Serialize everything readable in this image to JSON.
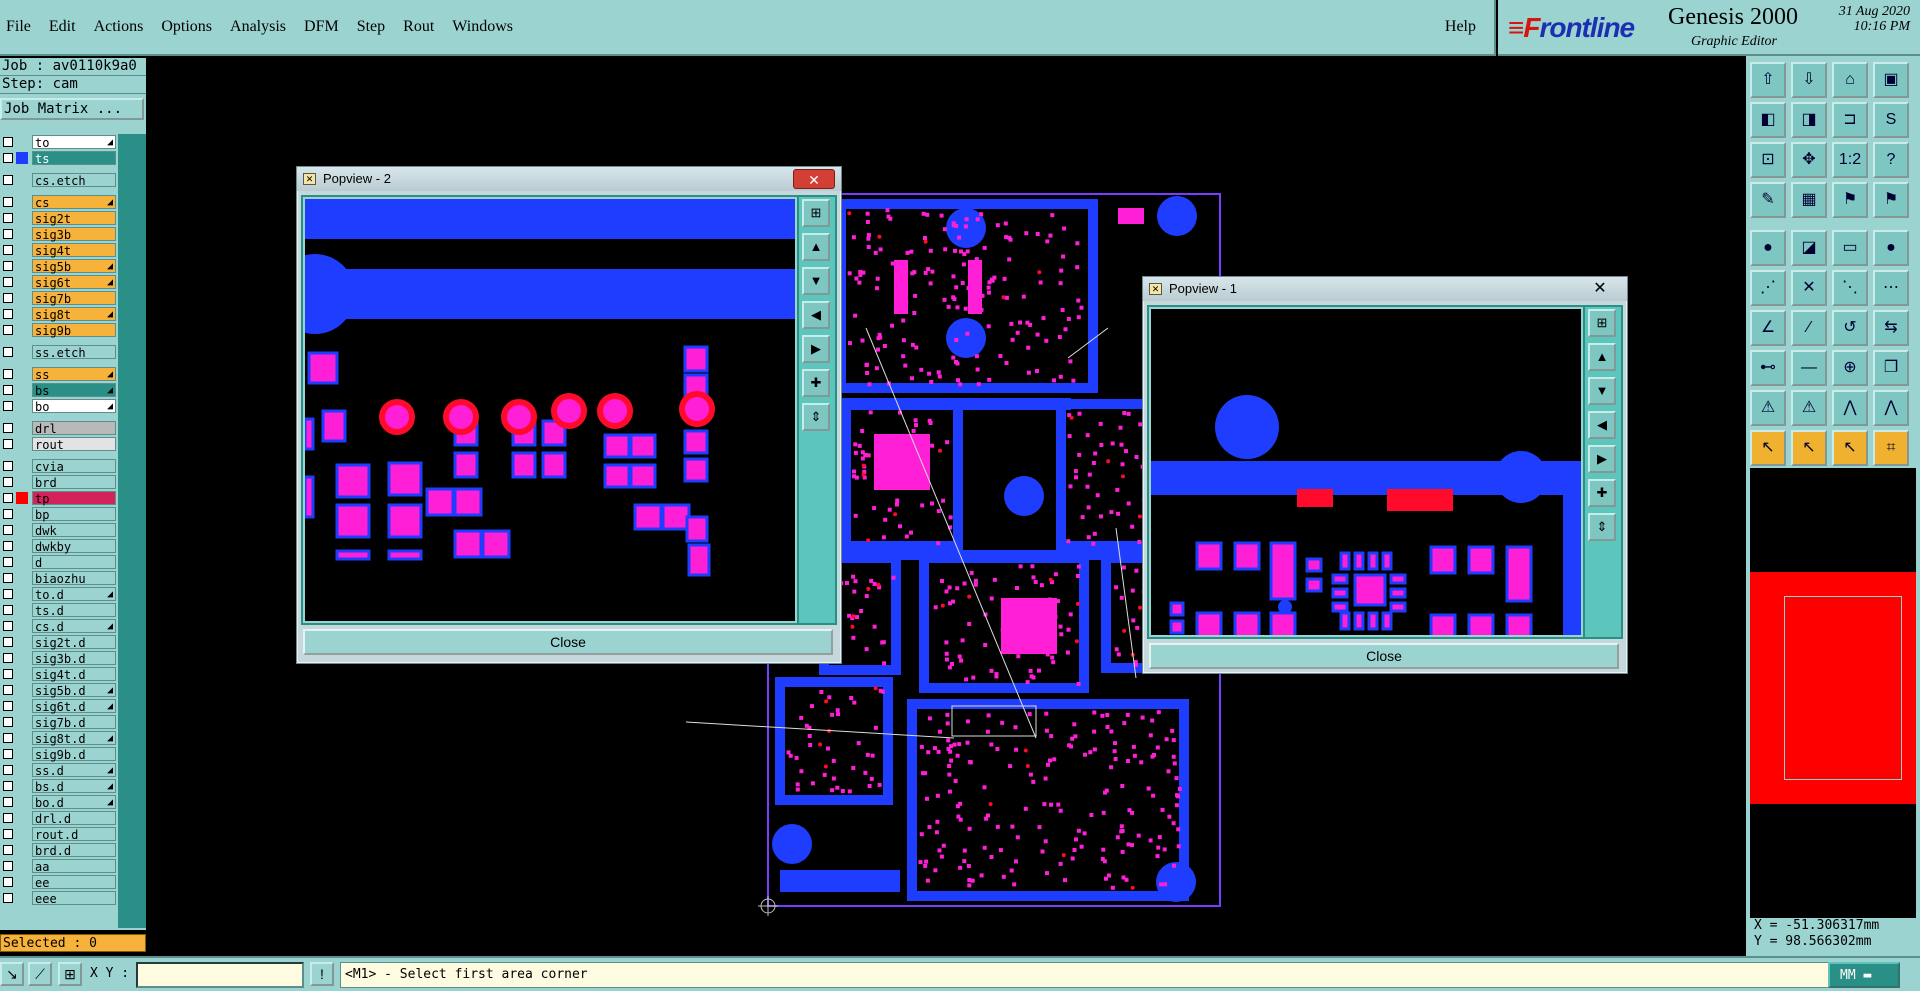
{
  "menu": {
    "items": [
      "File",
      "Edit",
      "Actions",
      "Options",
      "Analysis",
      "DFM",
      "Step",
      "Rout",
      "Windows"
    ],
    "help": "Help"
  },
  "brand": {
    "logo": "Frontline",
    "title": "Genesis 2000",
    "subtitle": "Graphic Editor",
    "date": "31 Aug 2020",
    "time": "10:16 PM"
  },
  "job": {
    "job_line": "Job : av0110k9a0",
    "step_line": "Step: cam",
    "matrix_button": "Job Matrix ..."
  },
  "layers": [
    {
      "name": "to",
      "color": "#ffffff",
      "indicator": "",
      "arrow": true,
      "group": 1
    },
    {
      "name": "ts",
      "color": "#2a8f86",
      "indicator": "#1f3dff",
      "arrow": false,
      "group": 1,
      "text_color": "#ffffff"
    },
    {
      "name": "cs.etch",
      "color": "#9bd3d0",
      "indicator": "",
      "arrow": false,
      "group": 2
    },
    {
      "name": "cs",
      "color": "#f6b23a",
      "indicator": "",
      "arrow": true,
      "group": 3
    },
    {
      "name": "sig2t",
      "color": "#f6b23a",
      "indicator": "",
      "arrow": false,
      "group": 3
    },
    {
      "name": "sig3b",
      "color": "#f6b23a",
      "indicator": "",
      "arrow": false,
      "group": 3
    },
    {
      "name": "sig4t",
      "color": "#f6b23a",
      "indicator": "",
      "arrow": false,
      "group": 3
    },
    {
      "name": "sig5b",
      "color": "#f6b23a",
      "indicator": "",
      "arrow": true,
      "group": 3
    },
    {
      "name": "sig6t",
      "color": "#f6b23a",
      "indicator": "",
      "arrow": true,
      "group": 3
    },
    {
      "name": "sig7b",
      "color": "#f6b23a",
      "indicator": "",
      "arrow": false,
      "group": 3
    },
    {
      "name": "sig8t",
      "color": "#f6b23a",
      "indicator": "",
      "arrow": true,
      "group": 3
    },
    {
      "name": "sig9b",
      "color": "#f6b23a",
      "indicator": "",
      "arrow": false,
      "group": 3
    },
    {
      "name": "ss.etch",
      "color": "#9bd3d0",
      "indicator": "",
      "arrow": false,
      "group": 4
    },
    {
      "name": "ss",
      "color": "#f6b23a",
      "indicator": "",
      "arrow": true,
      "group": 5
    },
    {
      "name": "bs",
      "color": "#2a8f86",
      "indicator": "",
      "arrow": true,
      "group": 5
    },
    {
      "name": "bo",
      "color": "#ffffff",
      "indicator": "",
      "arrow": true,
      "group": 5
    },
    {
      "name": "drl",
      "color": "#b9b9b9",
      "indicator": "",
      "arrow": false,
      "group": 6
    },
    {
      "name": "rout",
      "color": "#e3e3e3",
      "indicator": "",
      "arrow": false,
      "group": 6
    },
    {
      "name": "cvia",
      "color": "#9bd3d0",
      "indicator": "",
      "arrow": false,
      "group": 7
    },
    {
      "name": "brd",
      "color": "#9bd3d0",
      "indicator": "",
      "arrow": false,
      "group": 7
    },
    {
      "name": "tp",
      "color": "#d4225b",
      "indicator": "#ff0000",
      "arrow": false,
      "group": 7,
      "text_color": "#000000",
      "left_mark": "#1f3dff"
    },
    {
      "name": "bp",
      "color": "#9bd3d0",
      "indicator": "",
      "arrow": false,
      "group": 7
    },
    {
      "name": "dwk",
      "color": "#9bd3d0",
      "indicator": "",
      "arrow": false,
      "group": 7
    },
    {
      "name": "dwkby",
      "color": "#9bd3d0",
      "indicator": "",
      "arrow": false,
      "group": 7
    },
    {
      "name": "d",
      "color": "#9bd3d0",
      "indicator": "",
      "arrow": false,
      "group": 7
    },
    {
      "name": "biaozhu",
      "color": "#9bd3d0",
      "indicator": "",
      "arrow": false,
      "group": 7
    },
    {
      "name": "to.d",
      "color": "#9bd3d0",
      "indicator": "",
      "arrow": true,
      "group": 7
    },
    {
      "name": "ts.d",
      "color": "#9bd3d0",
      "indicator": "",
      "arrow": false,
      "group": 7
    },
    {
      "name": "cs.d",
      "color": "#9bd3d0",
      "indicator": "",
      "arrow": true,
      "group": 7
    },
    {
      "name": "sig2t.d",
      "color": "#9bd3d0",
      "indicator": "",
      "arrow": false,
      "group": 7
    },
    {
      "name": "sig3b.d",
      "color": "#9bd3d0",
      "indicator": "",
      "arrow": false,
      "group": 7
    },
    {
      "name": "sig4t.d",
      "color": "#9bd3d0",
      "indicator": "",
      "arrow": false,
      "group": 7
    },
    {
      "name": "sig5b.d",
      "color": "#9bd3d0",
      "indicator": "",
      "arrow": true,
      "group": 7
    },
    {
      "name": "sig6t.d",
      "color": "#9bd3d0",
      "indicator": "",
      "arrow": true,
      "group": 7
    },
    {
      "name": "sig7b.d",
      "color": "#9bd3d0",
      "indicator": "",
      "arrow": false,
      "group": 7
    },
    {
      "name": "sig8t.d",
      "color": "#9bd3d0",
      "indicator": "",
      "arrow": true,
      "group": 7
    },
    {
      "name": "sig9b.d",
      "color": "#9bd3d0",
      "indicator": "",
      "arrow": false,
      "group": 7
    },
    {
      "name": "ss.d",
      "color": "#9bd3d0",
      "indicator": "",
      "arrow": true,
      "group": 7
    },
    {
      "name": "bs.d",
      "color": "#9bd3d0",
      "indicator": "",
      "arrow": true,
      "group": 7
    },
    {
      "name": "bo.d",
      "color": "#9bd3d0",
      "indicator": "",
      "arrow": true,
      "group": 7
    },
    {
      "name": "drl.d",
      "color": "#9bd3d0",
      "indicator": "",
      "arrow": false,
      "group": 7
    },
    {
      "name": "rout.d",
      "color": "#9bd3d0",
      "indicator": "",
      "arrow": false,
      "group": 7
    },
    {
      "name": "brd.d",
      "color": "#9bd3d0",
      "indicator": "",
      "arrow": false,
      "group": 7
    },
    {
      "name": "aa",
      "color": "#9bd3d0",
      "indicator": "",
      "arrow": false,
      "group": 7
    },
    {
      "name": "ee",
      "color": "#9bd3d0",
      "indicator": "",
      "arrow": false,
      "group": 7
    },
    {
      "name": "eee",
      "color": "#9bd3d0",
      "indicator": "",
      "arrow": false,
      "group": 7
    }
  ],
  "selected": "Selected : 0",
  "bottom": {
    "xy_label": "X Y :",
    "xy_value": "",
    "message": "<M1> - Select first area corner",
    "unit": "MM"
  },
  "coords": {
    "x": "X = -51.306317mm",
    "y": "Y = 98.566302mm"
  },
  "popview2": {
    "title": "Popview - 2",
    "close": "Close"
  },
  "popview1": {
    "title": "Popview - 1",
    "close": "Close"
  },
  "toolbar_icons": [
    "load-icon",
    "save-icon",
    "home-icon",
    "window-icon",
    "pan-left-icon",
    "pan-right-icon",
    "fit-icon",
    "snap-icon",
    "zoom-fit-icon",
    "zoom-center-icon",
    "scale-1-2-icon",
    "query-icon",
    "pen-icon",
    "grid-icon",
    "layer-red-icon",
    "layer-red2-icon",
    "pad-icon",
    "line-icon",
    "ruler-icon",
    "dot-icon",
    "connect-icon",
    "cross-icon",
    "move-icon",
    "route-icon",
    "angle-icon",
    "slope-icon",
    "rotate-icon",
    "flip-icon",
    "measure-icon",
    "dash-icon",
    "target-icon",
    "copy-icon",
    "triangle-icon",
    "triangle2-icon",
    "arch-icon",
    "arch2-icon",
    "select-icon",
    "select-box-icon",
    "select-poly-icon",
    "select-net-icon"
  ],
  "colors": {
    "panel": "#9bd3d0",
    "panel_dark": "#2a8f86",
    "copper_blue": "#1f3dff",
    "pad_magenta": "#ff1fd6",
    "drill_red": "#ff0a2a",
    "board_outline": "#7a3cff"
  }
}
